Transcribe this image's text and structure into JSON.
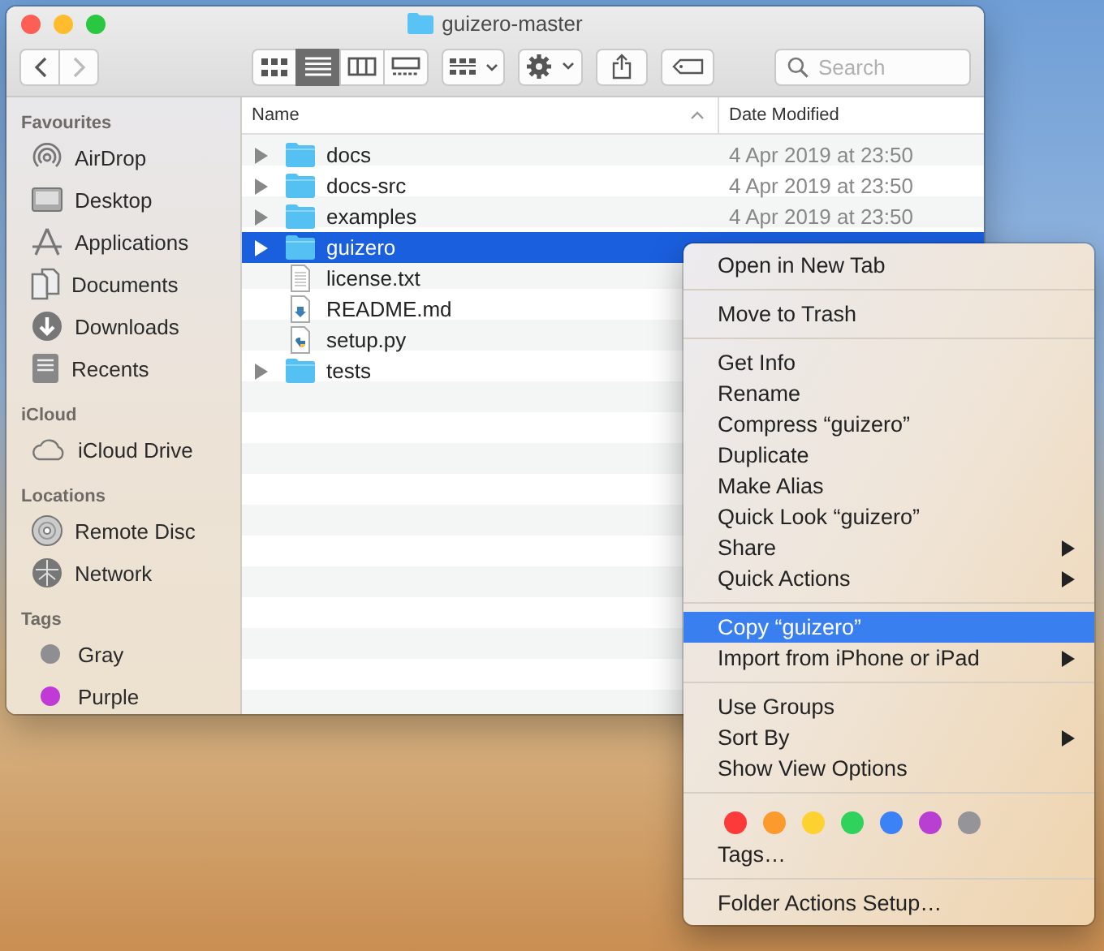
{
  "window": {
    "title": "guizero-master"
  },
  "toolbar": {
    "views": [
      {
        "kind": "icons",
        "selected": false
      },
      {
        "kind": "list",
        "selected": true
      },
      {
        "kind": "columns",
        "selected": false
      },
      {
        "kind": "gallery",
        "selected": false
      }
    ],
    "search": {
      "placeholder": "Search"
    }
  },
  "sidebar": {
    "sections": [
      {
        "title": "Favourites",
        "items": [
          {
            "kind": "airdrop",
            "label": "AirDrop"
          },
          {
            "kind": "desktop",
            "label": "Desktop"
          },
          {
            "kind": "apps",
            "label": "Applications"
          },
          {
            "kind": "documents",
            "label": "Documents"
          },
          {
            "kind": "downloads",
            "label": "Downloads"
          },
          {
            "kind": "recents",
            "label": "Recents"
          }
        ]
      },
      {
        "title": "iCloud",
        "items": [
          {
            "kind": "cloud",
            "label": "iCloud Drive"
          }
        ]
      },
      {
        "title": "Locations",
        "items": [
          {
            "kind": "disc",
            "label": "Remote Disc"
          },
          {
            "kind": "network",
            "label": "Network"
          }
        ]
      },
      {
        "title": "Tags",
        "items": [
          {
            "kind": "tag",
            "label": "Gray",
            "color": "#8e8e93"
          },
          {
            "kind": "tag",
            "label": "Purple",
            "color": "#c03ad6"
          }
        ]
      }
    ]
  },
  "table": {
    "columns": [
      "Name",
      "Date Modified"
    ],
    "rows": [
      {
        "kind": "folder",
        "expandable": true,
        "name": "docs",
        "date": "4 Apr 2019 at 23:50",
        "selected": false
      },
      {
        "kind": "folder",
        "expandable": true,
        "name": "docs-src",
        "date": "4 Apr 2019 at 23:50",
        "selected": false
      },
      {
        "kind": "folder",
        "expandable": true,
        "name": "examples",
        "date": "4 Apr 2019 at 23:50",
        "selected": false
      },
      {
        "kind": "folder",
        "expandable": true,
        "name": "guizero",
        "selected": true
      },
      {
        "kind": "text",
        "expandable": false,
        "name": "license.txt",
        "selected": false
      },
      {
        "kind": "markdown",
        "expandable": false,
        "name": "README.md",
        "selected": false
      },
      {
        "kind": "python",
        "expandable": false,
        "name": "setup.py",
        "selected": false
      },
      {
        "kind": "folder",
        "expandable": true,
        "name": "tests",
        "selected": false
      }
    ]
  },
  "context_menu": {
    "sections": [
      [
        {
          "kind": "item",
          "label": "Open in New Tab",
          "submenu": false,
          "selected": false
        }
      ],
      [
        {
          "kind": "item",
          "label": "Move to Trash",
          "submenu": false,
          "selected": false
        }
      ],
      [
        {
          "kind": "item",
          "label": "Get Info",
          "submenu": false,
          "selected": false
        },
        {
          "kind": "item",
          "label": "Rename",
          "submenu": false,
          "selected": false
        },
        {
          "kind": "item",
          "label": "Compress “guizero”",
          "submenu": false,
          "selected": false
        },
        {
          "kind": "item",
          "label": "Duplicate",
          "submenu": false,
          "selected": false
        },
        {
          "kind": "item",
          "label": "Make Alias",
          "submenu": false,
          "selected": false
        },
        {
          "kind": "item",
          "label": "Quick Look “guizero”",
          "submenu": false,
          "selected": false
        },
        {
          "kind": "item",
          "label": "Share",
          "submenu": true,
          "selected": false
        },
        {
          "kind": "item",
          "label": "Quick Actions",
          "submenu": true,
          "selected": false
        }
      ],
      [
        {
          "kind": "item",
          "label": "Copy “guizero”",
          "submenu": false,
          "selected": true
        },
        {
          "kind": "item",
          "label": "Import from iPhone or iPad",
          "submenu": true,
          "selected": false
        }
      ],
      [
        {
          "kind": "item",
          "label": "Use Groups",
          "submenu": false,
          "selected": false
        },
        {
          "kind": "item",
          "label": "Sort By",
          "submenu": true,
          "selected": false
        },
        {
          "kind": "item",
          "label": "Show View Options",
          "submenu": false,
          "selected": false
        }
      ],
      [
        {
          "kind": "colors",
          "colors": [
            {
              "color": "#fc3a3a"
            },
            {
              "color": "#fd9a2e"
            },
            {
              "color": "#fdd12f"
            },
            {
              "color": "#2fd25a"
            },
            {
              "color": "#3b82f6"
            },
            {
              "color": "#b93fd2"
            },
            {
              "color": "#949499"
            }
          ]
        },
        {
          "kind": "item",
          "label": "Tags…",
          "submenu": false,
          "selected": false
        }
      ],
      [
        {
          "kind": "item",
          "label": "Folder Actions Setup…",
          "submenu": false,
          "selected": false
        }
      ]
    ]
  }
}
